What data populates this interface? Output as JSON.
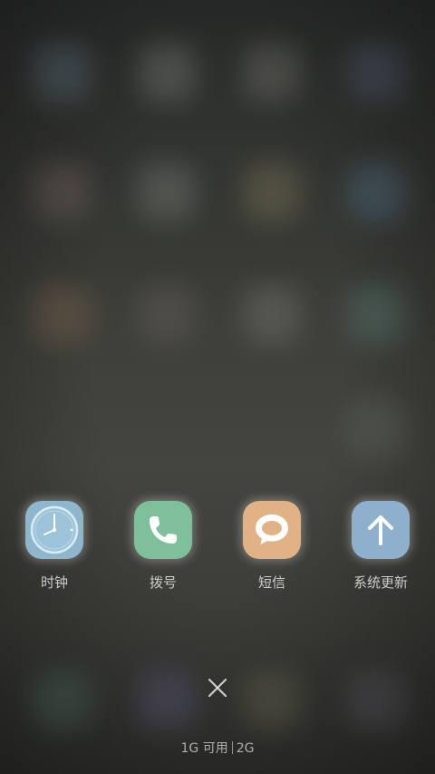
{
  "apps": [
    {
      "label": "时钟",
      "icon": "clock-icon",
      "color": "#8fb6cc"
    },
    {
      "label": "拨号",
      "icon": "phone-icon",
      "color": "#7fbf9c"
    },
    {
      "label": "短信",
      "icon": "message-icon",
      "color": "#e0b286"
    },
    {
      "label": "系统更新",
      "icon": "arrow-up-icon",
      "color": "#8fb0cc"
    }
  ],
  "close": {
    "icon": "close-icon"
  },
  "memory": {
    "available": "1G 可用",
    "total": "2G"
  }
}
